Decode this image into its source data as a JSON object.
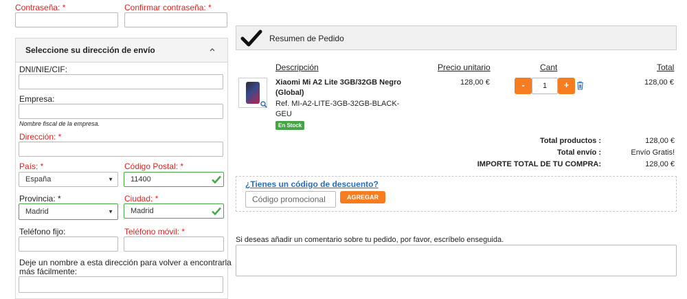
{
  "account": {
    "password_label": "Contraseña: *",
    "confirm_password_label": "Confirmar contraseña: *"
  },
  "address": {
    "panel_title": "Seleccione su dirección de envío",
    "dni_label": "DNI/NIE/CIF:",
    "company_label": "Empresa:",
    "company_hint": "Nombre fiscal de la empresa.",
    "address_label": "Dirección: *",
    "country_label": "País: *",
    "country_value": "España",
    "postcode_label": "Código Postal: *",
    "postcode_value": "11400",
    "province_label": "Provincia: *",
    "province_value": "Madrid",
    "city_label": "Ciudad: *",
    "city_value": "Madrid",
    "phone_label": "Teléfono fijo:",
    "mobile_label": "Teléfono móvil: *",
    "alias_label_line1": "Deje un nombre a esta dirección para volver a encontrarla",
    "alias_label_line2": "más fácilmente:"
  },
  "summary": {
    "title": "Resumen de Pedido",
    "col_description": "Descripción",
    "col_unit_price": "Precio unitario",
    "col_qty": "Cant",
    "col_total": "Total",
    "product": {
      "name_line1": "Xiaomi Mi A2 Lite 3GB/32GB Negro",
      "name_line2": "(Global)",
      "ref_line1": "Ref. MI-A2-LITE-3GB-32GB-BLACK-",
      "ref_line2": "GEU",
      "stock_badge": "En Stock",
      "unit_price": "128,00 €",
      "quantity": "1",
      "minus": "-",
      "plus": "+",
      "total": "128,00 €"
    },
    "totals": {
      "products_label": "Total productos :",
      "products_value": "128,00 €",
      "shipping_label": "Total envío :",
      "shipping_value": "Envío Gratis!",
      "grand_label": "IMPORTE TOTAL DE TU COMPRA:",
      "grand_value": "128,00 €"
    },
    "discount": {
      "question": "¿Tienes un código de descuento?",
      "placeholder": "Código promocional",
      "apply_button": "AGREGAR"
    },
    "comment_prompt": "Si deseas añadir un comentario sobre tu pedido, por favor, escríbelo enseguida."
  },
  "colors": {
    "required": "#e02020",
    "valid": "#46a84a",
    "accent_orange": "#f57c1f",
    "stock_green": "#47a447",
    "link_blue": "#2a6ebb"
  },
  "icons": {
    "summary": "checkmark-icon",
    "valid": "check-icon",
    "delete": "trash-icon",
    "zoom": "magnifier-icon",
    "collapse": "chevron-up-icon",
    "select": "caret-down-icon"
  }
}
